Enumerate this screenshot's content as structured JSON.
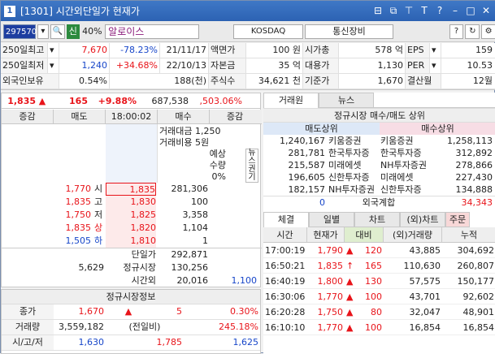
{
  "title": "[1301] 시간외단일가 현재가",
  "window_num": "1",
  "toolbar": {
    "code": "297570",
    "badge": "신",
    "ratio": "40%",
    "name": "알로이스",
    "market": "KOSDAQ",
    "sector": "통신장비",
    "help": "?"
  },
  "info_rows": [
    {
      "c1": "250일최고",
      "c2": "7,670",
      "c3": "-78.23%",
      "c4": "21/11/17",
      "c5": "액면가",
      "c6": "100 원",
      "c7": "시가총",
      "c8": "578 억",
      "c9": "EPS",
      "c10": "159"
    },
    {
      "c1": "250일최저",
      "c2": "1,240",
      "c3": "+34.68%",
      "c4": "22/10/13",
      "c5": "자본금",
      "c6": "35 억",
      "c7": "대용가",
      "c8": "1,130",
      "c9": "PER",
      "c10": "10.53"
    },
    {
      "c1": "외국인보유",
      "c2": "0.54%",
      "c3": "",
      "c4": "188(천)",
      "c5": "주식수",
      "c6": "34,621 천",
      "c7": "기준가",
      "c8": "1,670",
      "c9": "결산월",
      "c10": "12월"
    }
  ],
  "price_head": {
    "price": "1,835",
    "arrow": "▲",
    "change": "165",
    "rate": "+9.88%",
    "volume": "687,538",
    "vol_rate": ",503.06%"
  },
  "hoga_head": [
    "증감",
    "매도",
    "18:00:02",
    "매수",
    "증감"
  ],
  "hoga_info": {
    "amt_label": "거래대금",
    "amt": "1,250",
    "cost_label": "거래비용",
    "cost": "5원",
    "expect_label": "예상",
    "qty_label": "수량",
    "pct": "0%",
    "news": "뉴스권기"
  },
  "hoga_rows": [
    {
      "left": "1,770",
      "mark": "시",
      "price": "1,835",
      "vol": "281,306"
    },
    {
      "left": "1,835",
      "mark": "고",
      "price": "1,830",
      "vol": "100"
    },
    {
      "left": "1,750",
      "mark": "저",
      "price": "1,825",
      "vol": "3,358"
    },
    {
      "left": "1,835",
      "mark": "상",
      "price": "1,820",
      "vol": "1,104"
    },
    {
      "left": "1,505",
      "mark": "하",
      "price": "1,810",
      "vol": "1"
    }
  ],
  "hoga_bottom": [
    {
      "label": "단일가",
      "value": "292,871",
      "extra": ""
    },
    {
      "label": "정규시장",
      "value": "130,256",
      "extra": "",
      "left": "5,629"
    },
    {
      "label": "시간외",
      "value": "20,016",
      "extra": "1,100"
    }
  ],
  "reg_market": {
    "title": "정규시장정보",
    "rows": [
      {
        "a": "종가",
        "b": "1,670",
        "c": "▲",
        "d": "5",
        "e": "0.30%"
      },
      {
        "a": "거래량",
        "b": "3,559,182",
        "c": "(전일비)",
        "d": "",
        "e": "245.18%"
      },
      {
        "a": "시/고/저",
        "b": "1,630",
        "c": "1,785",
        "d": "",
        "e": "1,625"
      }
    ]
  },
  "right_tabs": [
    "거래원",
    "뉴스"
  ],
  "broker": {
    "title": "정규시장 매수/매도 상위",
    "sell_label": "매도상위",
    "buy_label": "매수상위",
    "rows": [
      {
        "sv": "1,240,167",
        "sn": "키움증권",
        "bn": "키움증권",
        "bv": "1,258,113"
      },
      {
        "sv": "281,781",
        "sn": "한국투자증",
        "bn": "한국투자증",
        "bv": "312,892"
      },
      {
        "sv": "215,587",
        "sn": "미래에셋",
        "bn": "NH투자증권",
        "bv": "278,866"
      },
      {
        "sv": "196,605",
        "sn": "신한투자증",
        "bn": "미래에셋",
        "bv": "227,430"
      },
      {
        "sv": "182,157",
        "sn": "NH투자증권",
        "bn": "신한투자증",
        "bv": "134,888"
      }
    ],
    "foreign": {
      "sv": "0",
      "label": "외국계합",
      "bv": "34,343"
    }
  },
  "tick_tabs": [
    "체결",
    "일별",
    "차트",
    "(외)차트",
    "주문"
  ],
  "tick_head": [
    "시간",
    "현재가",
    "대비",
    "(외)거래량",
    "누적"
  ],
  "ticks": [
    {
      "t": "17:00:19",
      "p": "1,790",
      "a": "▲",
      "d": "120",
      "v": "43,885",
      "c": "304,692"
    },
    {
      "t": "16:50:21",
      "p": "1,835",
      "a": "↑",
      "d": "165",
      "v": "110,630",
      "c": "260,807"
    },
    {
      "t": "16:40:19",
      "p": "1,800",
      "a": "▲",
      "d": "130",
      "v": "57,575",
      "c": "150,177"
    },
    {
      "t": "16:30:06",
      "p": "1,770",
      "a": "▲",
      "d": "100",
      "v": "43,701",
      "c": "92,602"
    },
    {
      "t": "16:20:28",
      "p": "1,750",
      "a": "▲",
      "d": "80",
      "v": "32,047",
      "c": "48,901"
    },
    {
      "t": "16:10:10",
      "p": "1,770",
      "a": "▲",
      "d": "100",
      "v": "16,854",
      "c": "16,854"
    }
  ]
}
